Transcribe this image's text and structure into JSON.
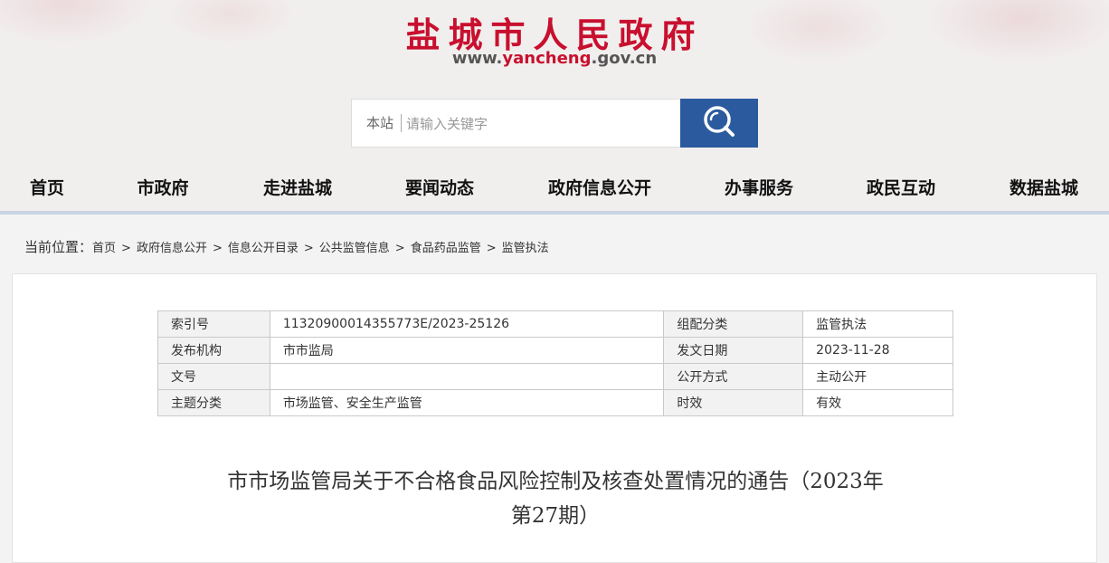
{
  "site": {
    "title": "盐城市人民政府",
    "url_prefix": "www.",
    "url_highlight": "yancheng",
    "url_suffix": ".gov.cn"
  },
  "search": {
    "scope": "本站",
    "placeholder": "请输入关键字",
    "icon": "search-icon"
  },
  "nav": {
    "items": [
      "首页",
      "市政府",
      "走进盐城",
      "要闻动态",
      "政府信息公开",
      "办事服务",
      "政民互动",
      "数据盐城"
    ]
  },
  "breadcrumb": {
    "lead": "当前位置：",
    "items": [
      "首页",
      "政府信息公开",
      "信息公开目录",
      "公共监管信息",
      "食品药品监管",
      "监管执法"
    ],
    "separator": ">"
  },
  "meta": {
    "index_label": "索引号",
    "index_value": "11320900014355773E/2023-25126",
    "category_label": "组配分类",
    "category_value": "监管执法",
    "publisher_label": "发布机构",
    "publisher_value": "市市监局",
    "date_label": "发文日期",
    "date_value": "2023-11-28",
    "docno_label": "文号",
    "docno_value": "",
    "public_label": "公开方式",
    "public_value": "主动公开",
    "topic_label": "主题分类",
    "topic_value": "市场监管、安全生产监管",
    "validity_label": "时效",
    "validity_value": "有效"
  },
  "article": {
    "title_line1": "市市场监管局关于不合格食品风险控制及核查处置情况的通告（2023年",
    "title_line2": "第27期）"
  },
  "colors": {
    "brand_red": "#c8102e",
    "search_button": "#2b5a9e",
    "nav_underline": "#c9d3e3"
  }
}
